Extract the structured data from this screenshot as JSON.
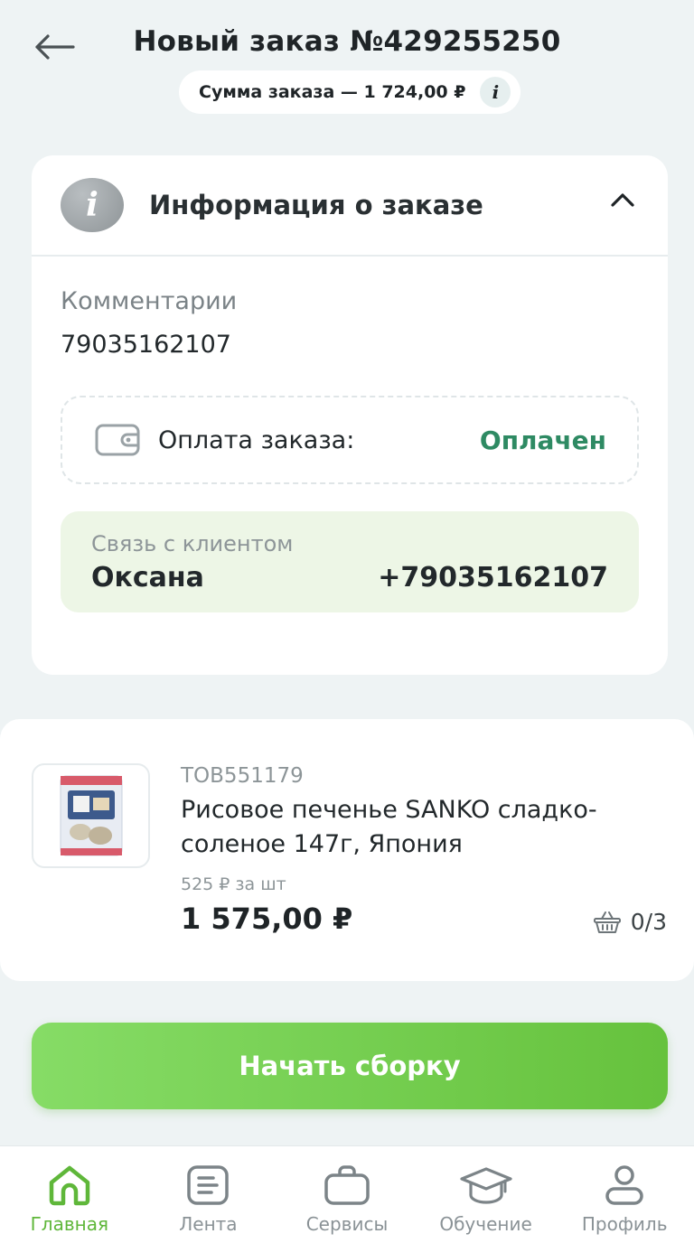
{
  "header": {
    "title": "Новый заказ №429255250",
    "sum_label": "Сумма заказа — 1 724,00 ₽"
  },
  "order_info": {
    "section_title": "Информация о заказе",
    "comment_label": "Комментарии",
    "comment_value": "79035162107",
    "payment_label": "Оплата заказа:",
    "payment_status": "Оплачен",
    "client_label": "Связь с клиентом",
    "client_name": "Оксана",
    "client_phone": "+79035162107"
  },
  "product": {
    "sku": "ТОВ551179",
    "name": "Рисовое печенье SANKO сладко-соленое 147г, Япония",
    "unit_price": "525 ₽ за шт",
    "total": "1 575,00 ₽",
    "picked_count": "0/3"
  },
  "actions": {
    "start_label": "Начать сборку"
  },
  "nav": {
    "items": [
      {
        "label": "Главная",
        "icon": "home-icon",
        "active": true
      },
      {
        "label": "Лента",
        "icon": "feed-icon",
        "active": false
      },
      {
        "label": "Сервисы",
        "icon": "briefcase-icon",
        "active": false
      },
      {
        "label": "Обучение",
        "icon": "graduation-cap-icon",
        "active": false
      },
      {
        "label": "Профиль",
        "icon": "profile-icon",
        "active": false
      }
    ]
  },
  "colors": {
    "accent": "#5fb73a",
    "paid_status": "#2e8a63",
    "client_box_bg": "#edf6e6",
    "background": "#eef3f4"
  }
}
